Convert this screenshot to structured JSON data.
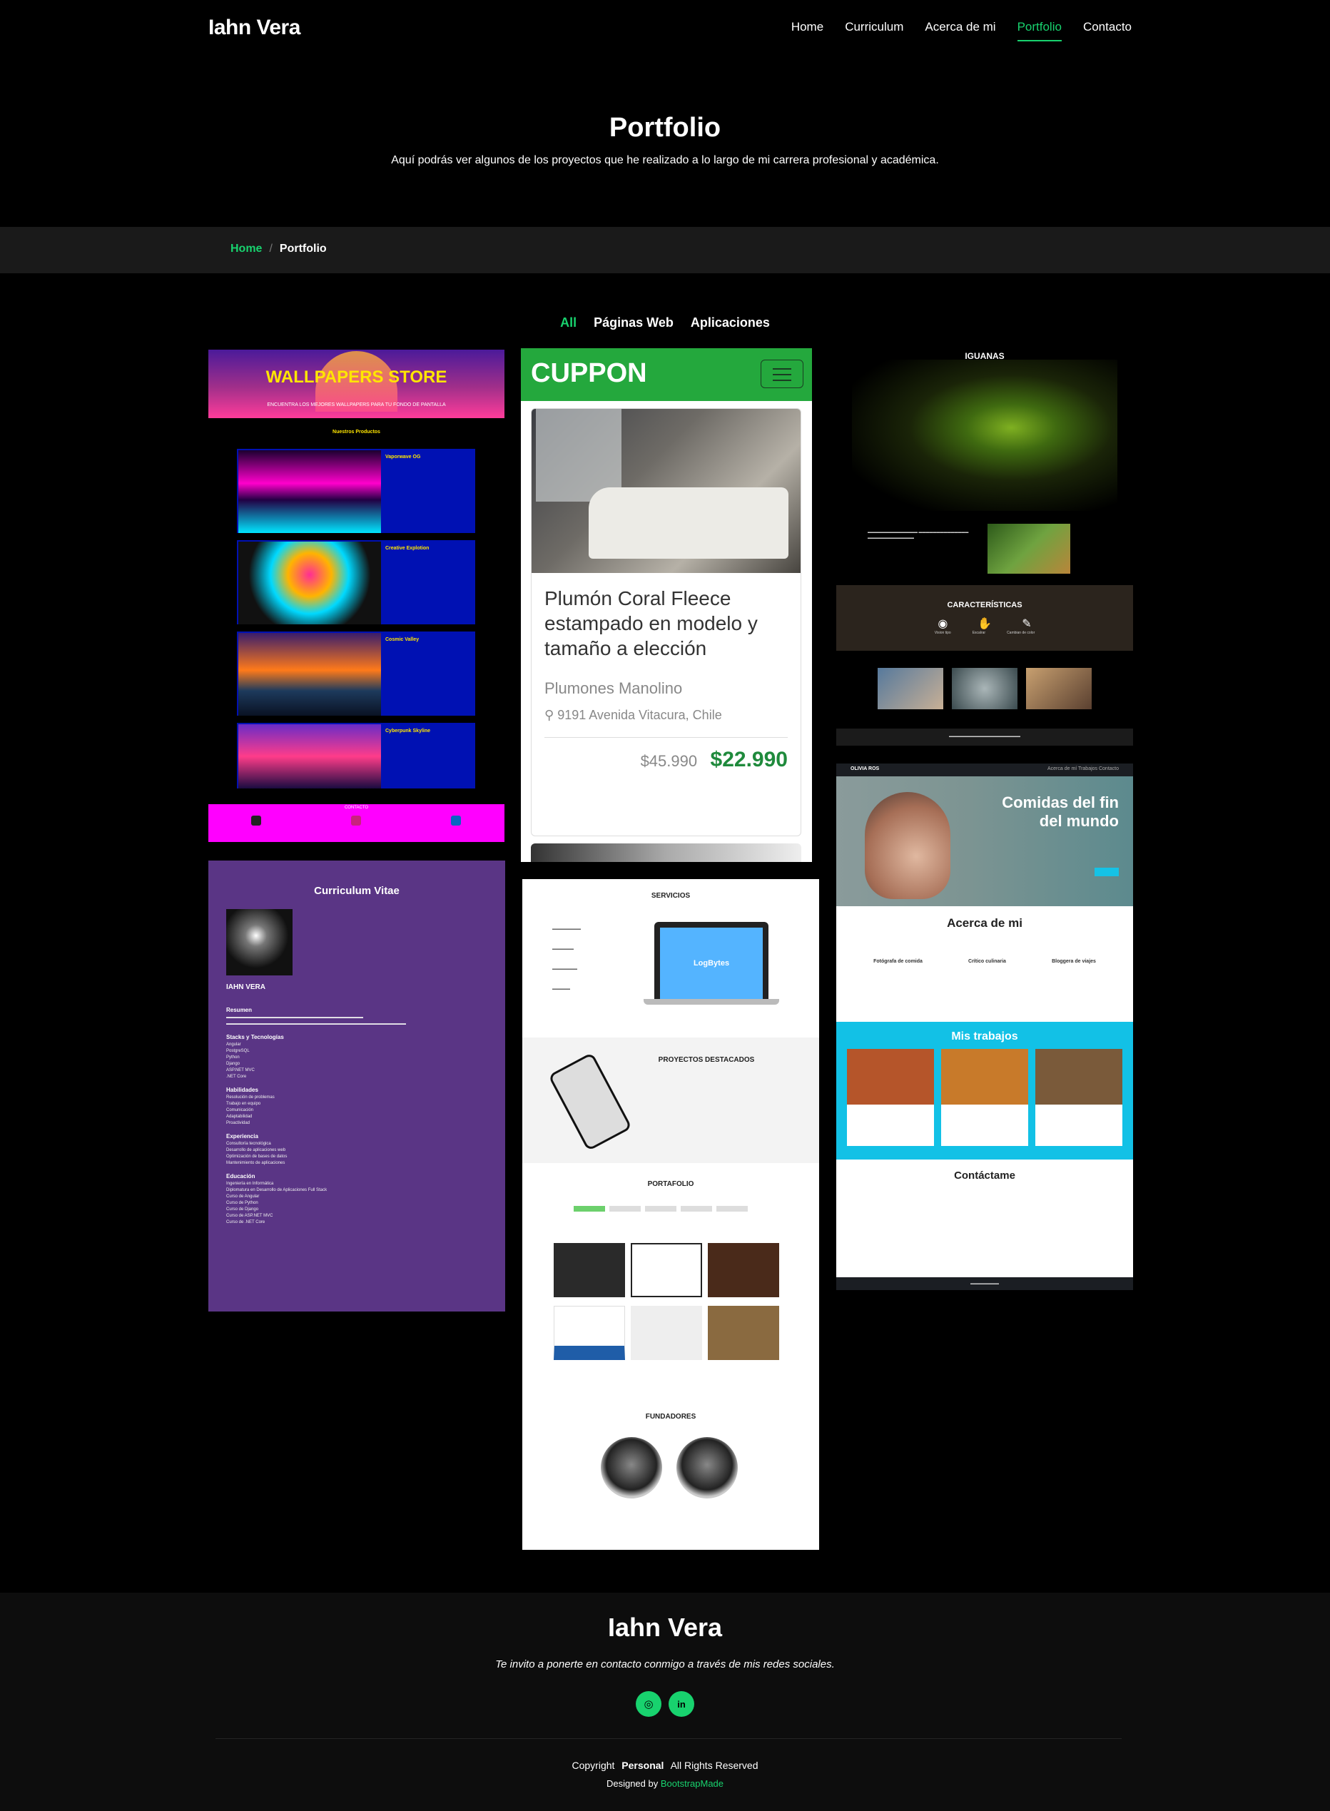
{
  "header": {
    "brand": "Iahn Vera",
    "nav": [
      {
        "label": "Home",
        "active": false
      },
      {
        "label": "Curriculum",
        "active": false
      },
      {
        "label": "Acerca de mi",
        "active": false
      },
      {
        "label": "Portfolio",
        "active": true
      },
      {
        "label": "Contacto",
        "active": false
      }
    ]
  },
  "hero": {
    "title": "Portfolio",
    "subtitle": "Aquí podrás ver algunos de los proyectos que he realizado a lo largo de mi carrera profesional y académica."
  },
  "breadcrumbs": {
    "home": "Home",
    "separator": "/",
    "current": "Portfolio"
  },
  "filters": [
    {
      "label": "All",
      "active": true
    },
    {
      "label": "Páginas Web",
      "active": false
    },
    {
      "label": "Aplicaciones",
      "active": false
    }
  ],
  "projects": {
    "wallpapers": {
      "title": "WALLPAPERS STORE",
      "subtitle": "ENCUENTRA LOS MEJORES WALLPAPERS PARA TU FONDO DE PANTALLA",
      "section": "Nuestros Productos",
      "items": [
        "Vaporwave OG",
        "Creative Explotion",
        "Cosmic Valley",
        "Cyberpunk Skyline"
      ],
      "footer": "CONTACTO"
    },
    "cuppon": {
      "logo": "CUPPON",
      "product": "Plumón Coral Fleece estampado en modelo y tamaño a elección",
      "store": "Plumones Manolino",
      "location": "9191 Avenida Vitacura, Chile",
      "old_price": "$45.990",
      "new_price": "$22.990"
    },
    "iguanas": {
      "title": "IGUANAS",
      "features": "CARACTERÍSTICAS",
      "feature_labels": [
        "Vision tipo",
        "Escalrar",
        "Cambian de color"
      ]
    },
    "olivia": {
      "brand": "OLIVIA ROS",
      "nav": "Acerca de mí   Trabajos   Contacto",
      "hero": "Comidas del fin del mundo",
      "about": "Acerca de mi",
      "columns": [
        "Fotógrafa de comida",
        "Crítico culinaria",
        "Bloggera de viajes"
      ],
      "works": "Mis trabajos",
      "contact": "Contáctame"
    },
    "cv": {
      "title": "Curriculum Vitae",
      "name": "IAHN VERA",
      "sections": [
        "Resumen",
        "Stacks y Tecnologías",
        "Habilidades",
        "Experiencia",
        "Educación"
      ],
      "stacks": [
        "Angular",
        "PostgreSQL",
        "Python",
        "Django",
        "ASP.NET MVC",
        ".NET Core"
      ],
      "skills": [
        "Resolución de problemas",
        "Trabajo en equipo",
        "Comunicación",
        "Adaptabilidad",
        "Proactividad"
      ],
      "experience": [
        "Consultoría tecnológica",
        "Desarrollo de aplicaciones web",
        "Optimización de bases de datos",
        "Mantenimiento de aplicaciones"
      ],
      "education": [
        "Ingeniería en Informática",
        "Diplomatura en Desarrollo de Aplicaciones Full Stack",
        "Curso de Angular",
        "Curso de Python",
        "Curso de Django",
        "Curso de ASP.NET MVC",
        "Curso de .NET Core"
      ]
    },
    "logbytes": {
      "services": "SERVICIOS",
      "logo": "LogBytes",
      "featured": "PROYECTOS DESTACADOS",
      "portfolio": "PORTAFOLIO",
      "founders": "FUNDADORES"
    }
  },
  "footer": {
    "name": "Iahn Vera",
    "text": "Te invito a ponerte en contacto conmigo a través de mis redes sociales.",
    "copyright_pre": "Copyright",
    "copyright_strong": "Personal",
    "copyright_post": "All Rights Reserved",
    "designed_pre": "Designed by",
    "designed_link": "BootstrapMade"
  },
  "colors": {
    "accent": "#18d26e",
    "background": "#000000"
  }
}
